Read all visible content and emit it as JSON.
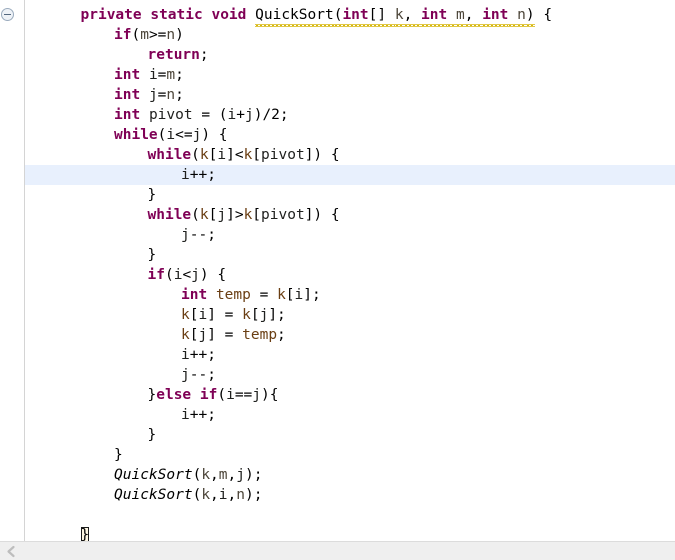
{
  "window": {
    "title": "Java Source Editor",
    "background_color": "#ffffff",
    "current_line_highlight_color": "#e8f0fd",
    "keyword_color": "#7f0055",
    "field_color": "#6a3e13",
    "parameter_color": "#4b4438",
    "squiggle_color": "#d5b60a",
    "scrollbar_color": "#efefef"
  },
  "gutter": {
    "fold_icon": "collapse-minus-icon",
    "fold_icon_state": "expanded"
  },
  "scrollbar": {
    "left_arrow_icon": "chevron-left-icon",
    "orientation": "horizontal"
  },
  "editor": {
    "current_line_index": 8,
    "lines": [
      {
        "index": 0,
        "indent": 1,
        "tokens": [
          {
            "text": "private",
            "type": "keyword"
          },
          {
            "text": " ",
            "type": "plain"
          },
          {
            "text": "static",
            "type": "keyword"
          },
          {
            "text": " ",
            "type": "plain"
          },
          {
            "text": "void",
            "type": "keyword"
          },
          {
            "text": " ",
            "type": "plain"
          },
          {
            "text": "QuickSort",
            "type": "plain",
            "squiggle": true
          },
          {
            "text": "(",
            "type": "punct",
            "squiggle": true
          },
          {
            "text": "int",
            "type": "keyword",
            "squiggle": true
          },
          {
            "text": "[] ",
            "type": "punct",
            "squiggle": true
          },
          {
            "text": "k",
            "type": "param",
            "squiggle": true
          },
          {
            "text": ", ",
            "type": "punct",
            "squiggle": true
          },
          {
            "text": "int",
            "type": "keyword",
            "squiggle": true
          },
          {
            "text": " ",
            "type": "plain",
            "squiggle": true
          },
          {
            "text": "m",
            "type": "param",
            "squiggle": true
          },
          {
            "text": ", ",
            "type": "punct",
            "squiggle": true
          },
          {
            "text": "int",
            "type": "keyword",
            "squiggle": true
          },
          {
            "text": " ",
            "type": "plain",
            "squiggle": true
          },
          {
            "text": "n",
            "type": "param",
            "squiggle": true
          },
          {
            "text": ")",
            "type": "punct",
            "squiggle": true
          },
          {
            "text": " {",
            "type": "punct"
          }
        ]
      },
      {
        "index": 1,
        "indent": 2,
        "tokens": [
          {
            "text": "if",
            "type": "keyword"
          },
          {
            "text": "(",
            "type": "punct"
          },
          {
            "text": "m",
            "type": "param"
          },
          {
            "text": ">=",
            "type": "punct"
          },
          {
            "text": "n",
            "type": "param"
          },
          {
            "text": ")",
            "type": "punct"
          }
        ]
      },
      {
        "index": 2,
        "indent": 3,
        "tokens": [
          {
            "text": "return",
            "type": "keyword"
          },
          {
            "text": ";",
            "type": "punct"
          }
        ]
      },
      {
        "index": 3,
        "indent": 2,
        "tokens": [
          {
            "text": "int",
            "type": "keyword"
          },
          {
            "text": " ",
            "type": "plain"
          },
          {
            "text": "i",
            "type": "local"
          },
          {
            "text": "=",
            "type": "punct"
          },
          {
            "text": "m",
            "type": "param"
          },
          {
            "text": ";",
            "type": "punct"
          }
        ]
      },
      {
        "index": 4,
        "indent": 2,
        "tokens": [
          {
            "text": "int",
            "type": "keyword"
          },
          {
            "text": " ",
            "type": "plain"
          },
          {
            "text": "j",
            "type": "local"
          },
          {
            "text": "=",
            "type": "punct"
          },
          {
            "text": "n",
            "type": "param"
          },
          {
            "text": ";",
            "type": "punct"
          }
        ]
      },
      {
        "index": 5,
        "indent": 2,
        "tokens": [
          {
            "text": "int",
            "type": "keyword"
          },
          {
            "text": " ",
            "type": "plain"
          },
          {
            "text": "pivot",
            "type": "local"
          },
          {
            "text": " = (",
            "type": "punct"
          },
          {
            "text": "i",
            "type": "local"
          },
          {
            "text": "+",
            "type": "punct"
          },
          {
            "text": "j",
            "type": "local"
          },
          {
            "text": ")/2;",
            "type": "punct"
          }
        ]
      },
      {
        "index": 6,
        "indent": 2,
        "tokens": [
          {
            "text": "while",
            "type": "keyword"
          },
          {
            "text": "(",
            "type": "punct"
          },
          {
            "text": "i",
            "type": "local"
          },
          {
            "text": "<=",
            "type": "punct"
          },
          {
            "text": "j",
            "type": "local"
          },
          {
            "text": ") {",
            "type": "punct"
          }
        ]
      },
      {
        "index": 7,
        "indent": 3,
        "tokens": [
          {
            "text": "while",
            "type": "keyword"
          },
          {
            "text": "(",
            "type": "punct"
          },
          {
            "text": "k",
            "type": "field"
          },
          {
            "text": "[",
            "type": "punct"
          },
          {
            "text": "i",
            "type": "local"
          },
          {
            "text": "]<",
            "type": "punct"
          },
          {
            "text": "k",
            "type": "field"
          },
          {
            "text": "[",
            "type": "punct"
          },
          {
            "text": "pivot",
            "type": "local"
          },
          {
            "text": "]) {",
            "type": "punct"
          }
        ]
      },
      {
        "index": 8,
        "indent": 4,
        "tokens": [
          {
            "text": "i",
            "type": "local"
          },
          {
            "text": "++;",
            "type": "punct"
          }
        ]
      },
      {
        "index": 9,
        "indent": 3,
        "tokens": [
          {
            "text": "}",
            "type": "punct"
          }
        ]
      },
      {
        "index": 10,
        "indent": 3,
        "tokens": [
          {
            "text": "while",
            "type": "keyword"
          },
          {
            "text": "(",
            "type": "punct"
          },
          {
            "text": "k",
            "type": "field"
          },
          {
            "text": "[",
            "type": "punct"
          },
          {
            "text": "j",
            "type": "local"
          },
          {
            "text": "]>",
            "type": "punct"
          },
          {
            "text": "k",
            "type": "field"
          },
          {
            "text": "[",
            "type": "punct"
          },
          {
            "text": "pivot",
            "type": "local"
          },
          {
            "text": "]) {",
            "type": "punct"
          }
        ]
      },
      {
        "index": 11,
        "indent": 4,
        "tokens": [
          {
            "text": "j",
            "type": "local"
          },
          {
            "text": "--;",
            "type": "punct"
          }
        ]
      },
      {
        "index": 12,
        "indent": 3,
        "tokens": [
          {
            "text": "}",
            "type": "punct"
          }
        ]
      },
      {
        "index": 13,
        "indent": 3,
        "tokens": [
          {
            "text": "if",
            "type": "keyword"
          },
          {
            "text": "(",
            "type": "punct"
          },
          {
            "text": "i",
            "type": "local"
          },
          {
            "text": "<",
            "type": "punct"
          },
          {
            "text": "j",
            "type": "local"
          },
          {
            "text": ") {",
            "type": "punct"
          }
        ]
      },
      {
        "index": 14,
        "indent": 4,
        "tokens": [
          {
            "text": "int",
            "type": "keyword"
          },
          {
            "text": " ",
            "type": "plain"
          },
          {
            "text": "temp",
            "type": "field"
          },
          {
            "text": " = ",
            "type": "punct"
          },
          {
            "text": "k",
            "type": "field"
          },
          {
            "text": "[",
            "type": "punct"
          },
          {
            "text": "i",
            "type": "local"
          },
          {
            "text": "];",
            "type": "punct"
          }
        ]
      },
      {
        "index": 15,
        "indent": 4,
        "tokens": [
          {
            "text": "k",
            "type": "field"
          },
          {
            "text": "[",
            "type": "punct"
          },
          {
            "text": "i",
            "type": "local"
          },
          {
            "text": "] = ",
            "type": "punct"
          },
          {
            "text": "k",
            "type": "field"
          },
          {
            "text": "[",
            "type": "punct"
          },
          {
            "text": "j",
            "type": "local"
          },
          {
            "text": "];",
            "type": "punct"
          }
        ]
      },
      {
        "index": 16,
        "indent": 4,
        "tokens": [
          {
            "text": "k",
            "type": "field"
          },
          {
            "text": "[",
            "type": "punct"
          },
          {
            "text": "j",
            "type": "local"
          },
          {
            "text": "] = ",
            "type": "punct"
          },
          {
            "text": "temp",
            "type": "field"
          },
          {
            "text": ";",
            "type": "punct"
          }
        ]
      },
      {
        "index": 17,
        "indent": 4,
        "tokens": [
          {
            "text": "i",
            "type": "local"
          },
          {
            "text": "++;",
            "type": "punct"
          }
        ]
      },
      {
        "index": 18,
        "indent": 4,
        "tokens": [
          {
            "text": "j",
            "type": "local"
          },
          {
            "text": "--;",
            "type": "punct"
          }
        ]
      },
      {
        "index": 19,
        "indent": 3,
        "tokens": [
          {
            "text": "}",
            "type": "punct"
          },
          {
            "text": "else",
            "type": "keyword"
          },
          {
            "text": " ",
            "type": "plain"
          },
          {
            "text": "if",
            "type": "keyword"
          },
          {
            "text": "(",
            "type": "punct"
          },
          {
            "text": "i",
            "type": "local"
          },
          {
            "text": "==",
            "type": "punct"
          },
          {
            "text": "j",
            "type": "local"
          },
          {
            "text": "){",
            "type": "punct"
          }
        ]
      },
      {
        "index": 20,
        "indent": 4,
        "tokens": [
          {
            "text": "i",
            "type": "local"
          },
          {
            "text": "++;",
            "type": "punct"
          }
        ]
      },
      {
        "index": 21,
        "indent": 3,
        "tokens": [
          {
            "text": "}",
            "type": "punct"
          }
        ]
      },
      {
        "index": 22,
        "indent": 2,
        "tokens": [
          {
            "text": "}",
            "type": "punct"
          }
        ]
      },
      {
        "index": 23,
        "indent": 2,
        "tokens": [
          {
            "text": "QuickSort",
            "type": "static-call"
          },
          {
            "text": "(",
            "type": "punct"
          },
          {
            "text": "k",
            "type": "param"
          },
          {
            "text": ",",
            "type": "punct"
          },
          {
            "text": "m",
            "type": "param"
          },
          {
            "text": ",",
            "type": "punct"
          },
          {
            "text": "j",
            "type": "local"
          },
          {
            "text": ");",
            "type": "punct"
          }
        ]
      },
      {
        "index": 24,
        "indent": 2,
        "tokens": [
          {
            "text": "QuickSort",
            "type": "static-call"
          },
          {
            "text": "(",
            "type": "punct"
          },
          {
            "text": "k",
            "type": "param"
          },
          {
            "text": ",",
            "type": "punct"
          },
          {
            "text": "i",
            "type": "local"
          },
          {
            "text": ",",
            "type": "punct"
          },
          {
            "text": "n",
            "type": "param"
          },
          {
            "text": ");",
            "type": "punct"
          }
        ]
      },
      {
        "index": 25,
        "indent": 0,
        "tokens": []
      },
      {
        "index": 26,
        "indent": 1,
        "tokens": [
          {
            "text": "}",
            "type": "punct",
            "bracket_match": true,
            "caret_after": true
          }
        ]
      }
    ]
  }
}
